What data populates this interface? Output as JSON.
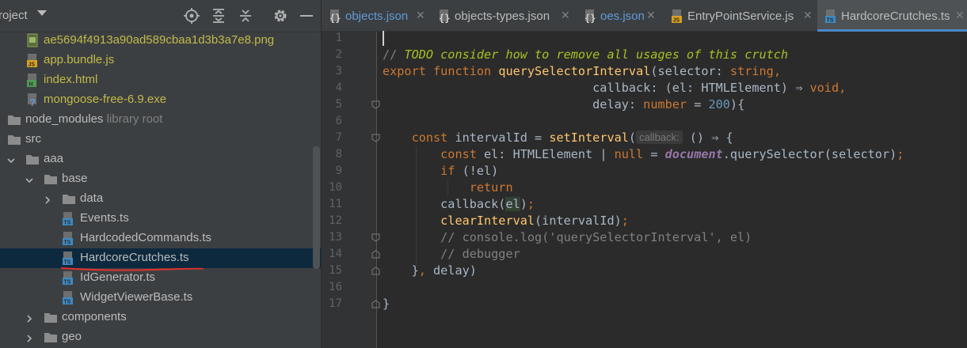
{
  "project": {
    "title": "roject",
    "toolbar_icons": [
      "locate-icon",
      "expand-all-icon",
      "collapse-all-icon",
      "gear-icon",
      "minimize-icon"
    ]
  },
  "tree": [
    {
      "label": "ae5694f4913a90ad589cbaa1d3b3a7e8.png",
      "icon": "png-file-icon",
      "style": "yellow"
    },
    {
      "label": "app.bundle.js",
      "icon": "js-file-icon",
      "style": "yellow"
    },
    {
      "label": "index.html",
      "icon": "html-file-icon",
      "style": "yellow"
    },
    {
      "label": "mongoose-free-6.9.exe",
      "icon": "unknown-file-icon",
      "style": "yellow"
    },
    {
      "label": "node_modules",
      "suffix": "library root",
      "icon": "folder-icon"
    },
    {
      "label": "src",
      "icon": "folder-icon"
    },
    {
      "label": "aaa",
      "icon": "folder-icon"
    },
    {
      "label": "base",
      "icon": "folder-icon"
    },
    {
      "label": "data",
      "icon": "folder-icon"
    },
    {
      "label": "Events.ts",
      "icon": "ts-file-icon"
    },
    {
      "label": "HardcodedCommands.ts",
      "icon": "ts-file-icon"
    },
    {
      "label": "HardcoreCrutches.ts",
      "icon": "ts-file-icon",
      "selected": true
    },
    {
      "label": "IdGenerator.ts",
      "icon": "ts-file-icon"
    },
    {
      "label": "WidgetViewerBase.ts",
      "icon": "ts-file-icon"
    },
    {
      "label": "components",
      "icon": "folder-icon"
    },
    {
      "label": "geo",
      "icon": "folder-icon"
    }
  ],
  "tabs": [
    {
      "label": "objects.json",
      "icon": "json-file-icon"
    },
    {
      "label": "objects-types.json",
      "icon": "json-file-icon"
    },
    {
      "label": "oes.json",
      "icon": "json-file-icon"
    },
    {
      "label": "EntryPointService.js",
      "icon": "js-file-icon"
    },
    {
      "label": "HardcoreCrutches.ts",
      "icon": "ts-file-icon",
      "active": true
    }
  ],
  "editor": {
    "line_numbers": [
      "1",
      "2",
      "3",
      "4",
      "5",
      "6",
      "7",
      "8",
      "9",
      "10",
      "11",
      "12",
      "13",
      "14",
      "15",
      "16",
      "17"
    ],
    "inlay_hint": "callback:",
    "code": {
      "l2_comment": "// ",
      "l2_todo": "TODO consider how to remove all usages of this crutch",
      "l3_export": "export",
      "l3_function": "function",
      "l3_name": "querySelectorInterval",
      "l3_rest": "(selector: ",
      "l3_type": "string",
      "l3_comma": ",",
      "l4_start": "                             callback: (el: HTMLElement) ",
      "l4_arrow": "⇒",
      "l4_void": "void",
      "l4_comma": ",",
      "l5_start": "                             delay: ",
      "l5_type": "number",
      "l5_eq": " = ",
      "l5_num": "200",
      "l5_end": "){",
      "l7_indent": "    ",
      "l7_const": "const",
      "l7_var": " intervalId = ",
      "l7_fn": "setInterval",
      "l7_paren": "(",
      "l7_arrow": " () ⇒ {",
      "l8_indent": "        ",
      "l8_const": "const",
      "l8_decl": " el: HTMLElement | ",
      "l8_null": "null",
      "l8_eq": " = ",
      "l8_doc": "document",
      "l8_rest": ".querySelector(selector)",
      "l8_semi": ";",
      "l9_indent": "        ",
      "l9_if": "if",
      "l9_rest": " (!el)",
      "l10_indent": "            ",
      "l10_return": "return",
      "l11_indent": "        ",
      "l11_call": "callback(",
      "l11_param": "el",
      "l11_end": ")",
      "l11_semi": ";",
      "l12_indent": "        ",
      "l12_fn": "clearInterval",
      "l12_rest": "(intervalId)",
      "l12_semi": ";",
      "l13": "        // console.log('querySelectorInterval', el)",
      "l14": "        // debugger",
      "l15_start": "    }",
      "l15_comma": ",",
      "l15_rest": " delay)",
      "l17": "}"
    }
  }
}
